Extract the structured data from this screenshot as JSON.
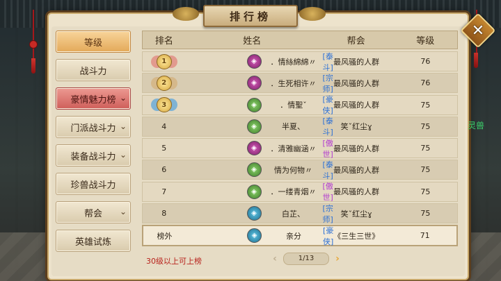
{
  "window": {
    "title": "排行榜",
    "close_glyph": "✕"
  },
  "background_text": "灵兽",
  "sidebar": {
    "items": [
      {
        "label": "等级",
        "state": "gold",
        "chevron": false
      },
      {
        "label": "战斗力",
        "state": "normal",
        "chevron": false
      },
      {
        "label": "豪情魅力榜",
        "state": "red",
        "chevron": true
      },
      {
        "label": "门派战斗力",
        "state": "normal",
        "chevron": true
      },
      {
        "label": "装备战斗力",
        "state": "normal",
        "chevron": true
      },
      {
        "label": "珍兽战斗力",
        "state": "normal",
        "chevron": false
      },
      {
        "label": "帮会",
        "state": "normal",
        "chevron": true
      },
      {
        "label": "英雄试炼",
        "state": "normal",
        "chevron": false
      }
    ]
  },
  "table": {
    "headers": {
      "rank": "排名",
      "name": "姓名",
      "guild": "帮会",
      "level": "等级"
    },
    "rows": [
      {
        "rank": "1",
        "medal": "m1",
        "avatar": "purple",
        "name": "．情絲綿綿〃",
        "title": "[泰斗]",
        "title_color": "#2a6fd6",
        "guild": "最风骚的人群",
        "level": "76"
      },
      {
        "rank": "2",
        "medal": "m2",
        "avatar": "purple",
        "name": "．生死相许〃",
        "title": "[宗师]",
        "title_color": "#2a6fd6",
        "guild": "最风骚的人群",
        "level": "76"
      },
      {
        "rank": "3",
        "medal": "m3",
        "avatar": "green",
        "name": "．情聖ˇ",
        "title": "[豪侠]",
        "title_color": "#2a6fd6",
        "guild": "最风骚的人群",
        "level": "75"
      },
      {
        "rank": "4",
        "medal": "",
        "avatar": "green",
        "name": "半夏、",
        "title": "[泰斗]",
        "title_color": "#2a6fd6",
        "guild": "笑ˇ红尘ɣ",
        "level": "75"
      },
      {
        "rank": "5",
        "medal": "",
        "avatar": "purple",
        "name": "．清雅幽涵〃",
        "title": "[傲世]",
        "title_color": "#b13ad0",
        "guild": "最风骚的人群",
        "level": "75"
      },
      {
        "rank": "6",
        "medal": "",
        "avatar": "green",
        "name": "情为何物〃",
        "title": "[泰斗]",
        "title_color": "#2a6fd6",
        "guild": "最风骚的人群",
        "level": "75"
      },
      {
        "rank": "7",
        "medal": "",
        "avatar": "green",
        "name": "．一缕青烟〃",
        "title": "[傲世]",
        "title_color": "#b13ad0",
        "guild": "最风骚的人群",
        "level": "75"
      },
      {
        "rank": "8",
        "medal": "",
        "avatar": "blue",
        "name": "白芷、",
        "title": "[宗师]",
        "title_color": "#2a6fd6",
        "guild": "笑ˇ红尘ɣ",
        "level": "75"
      }
    ],
    "self_row": {
      "rank": "榜外",
      "avatar": "blue",
      "name": "亲分",
      "title": "[豪侠]",
      "title_color": "#2a6fd6",
      "guild": "《三生三世》",
      "level": "71"
    }
  },
  "footer": {
    "hint": "30级以上可上榜"
  },
  "pager": {
    "current": "1/13",
    "prev_glyph": "‹",
    "next_glyph": "›"
  },
  "colors": {
    "accent_gold": "#e3a959",
    "accent_red": "#cf5e5a",
    "hint_red": "#b8221c"
  }
}
